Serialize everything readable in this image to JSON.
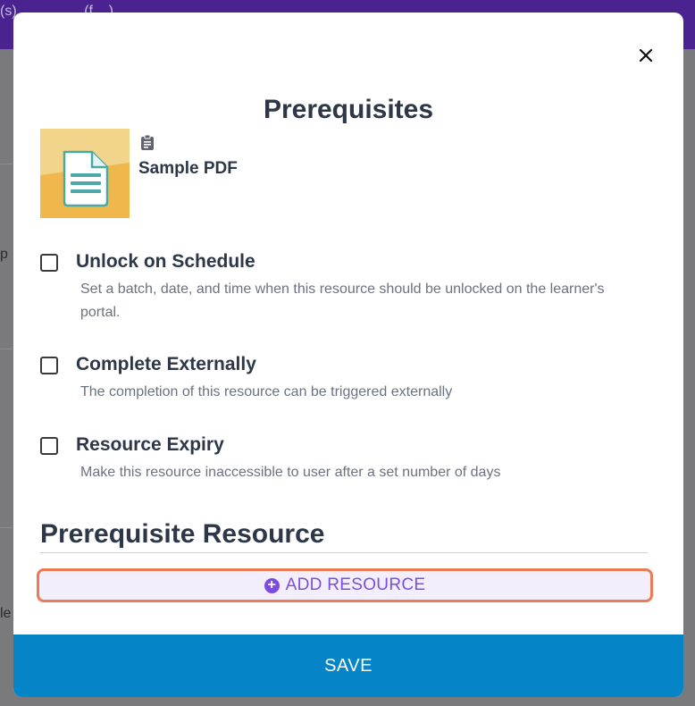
{
  "background": {
    "topbar_text": "(s) ... ... ... ... (f ...)",
    "left_fragment_1": "p",
    "left_fragment_2": "le"
  },
  "modal": {
    "title": "Prerequisites",
    "close_icon": "close-icon",
    "resource": {
      "type_icon": "clipboard-icon",
      "name": "Sample PDF"
    },
    "options": [
      {
        "title": "Unlock on Schedule",
        "description": "Set a batch, date, and time when this resource should be unlocked on the learner's portal.",
        "checked": false
      },
      {
        "title": "Complete Externally",
        "description": "The completion of this resource can be triggered externally",
        "checked": false
      },
      {
        "title": "Resource Expiry",
        "description": "Make this resource inaccessible to user after a set number of days",
        "checked": false
      }
    ],
    "section_title": "Prerequisite Resource",
    "add_button_label": "ADD RESOURCE",
    "save_button_label": "SAVE"
  },
  "colors": {
    "brand_purple": "#4b2390",
    "accent_purple": "#7c4ddd",
    "focus_orange": "#ed7a52",
    "save_blue": "#0584c7",
    "text_dark": "#2d3748",
    "text_muted": "#6b7280"
  }
}
